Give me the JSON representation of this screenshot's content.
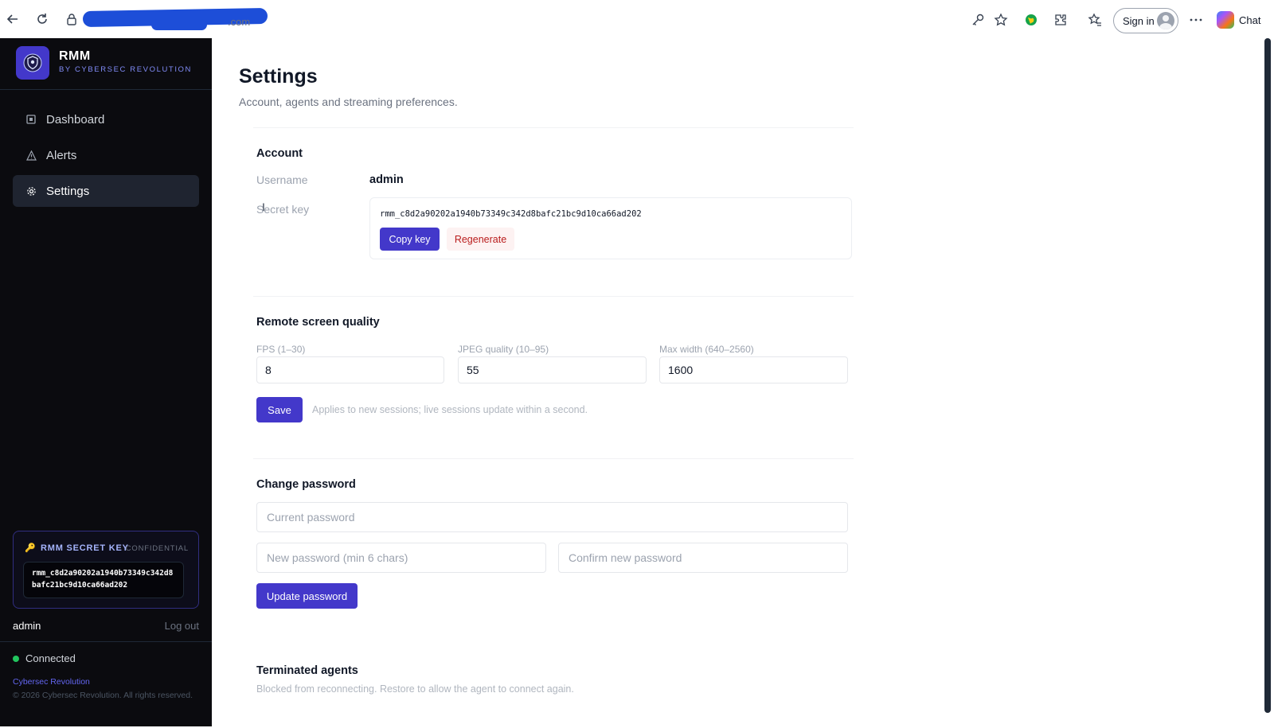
{
  "browser": {
    "url_tail": ".com",
    "sign_in_label": "Sign in",
    "chat_label": "Chat"
  },
  "sidebar": {
    "brand_name": "RMM",
    "brand_sub": "BY CYBERSEC REVOLUTION",
    "items": [
      {
        "label": "Dashboard",
        "icon": "square-icon"
      },
      {
        "label": "Alerts",
        "icon": "warning-triangle-icon"
      },
      {
        "label": "Settings",
        "icon": "gear-icon",
        "active": true
      }
    ],
    "key_card": {
      "title": "RMM SECRET KEY",
      "confidential": "CONFIDENTIAL",
      "key": "rmm_c8d2a90202a1940b73349c342d8bafc21bc9d10ca66ad202"
    },
    "user": "admin",
    "logout_label": "Log out",
    "status": "Connected",
    "status_color": "#22c55e",
    "org": "Cybersec Revolution",
    "copyright": "© 2026 Cybersec Revolution. All rights reserved."
  },
  "page": {
    "title": "Settings",
    "subtitle": "Account, agents and streaming preferences."
  },
  "account": {
    "title": "Account",
    "username_label": "Username",
    "username_value": "admin",
    "secret_label": "Secret key",
    "secret_value": "rmm_c8d2a90202a1940b73349c342d8bafc21bc9d10ca66ad202",
    "copy_label": "Copy key",
    "regen_label": "Regenerate"
  },
  "quality": {
    "title": "Remote screen quality",
    "fps_label": "FPS (1–30)",
    "fps_value": "8",
    "jpeg_label": "JPEG quality (10–95)",
    "jpeg_value": "55",
    "width_label": "Max width (640–2560)",
    "width_value": "1600",
    "save_label": "Save",
    "hint": "Applies to new sessions; live sessions update within a second."
  },
  "password": {
    "title": "Change password",
    "current_placeholder": "Current password",
    "new_placeholder": "New password (min 6 chars)",
    "confirm_placeholder": "Confirm new password",
    "update_label": "Update password"
  },
  "terminated": {
    "title": "Terminated agents",
    "subtitle": "Blocked from reconnecting. Restore to allow the agent to connect again."
  },
  "colors": {
    "accent": "#4338ca",
    "sidebar_bg": "#0b0b0f",
    "danger": "#b91c1c"
  }
}
